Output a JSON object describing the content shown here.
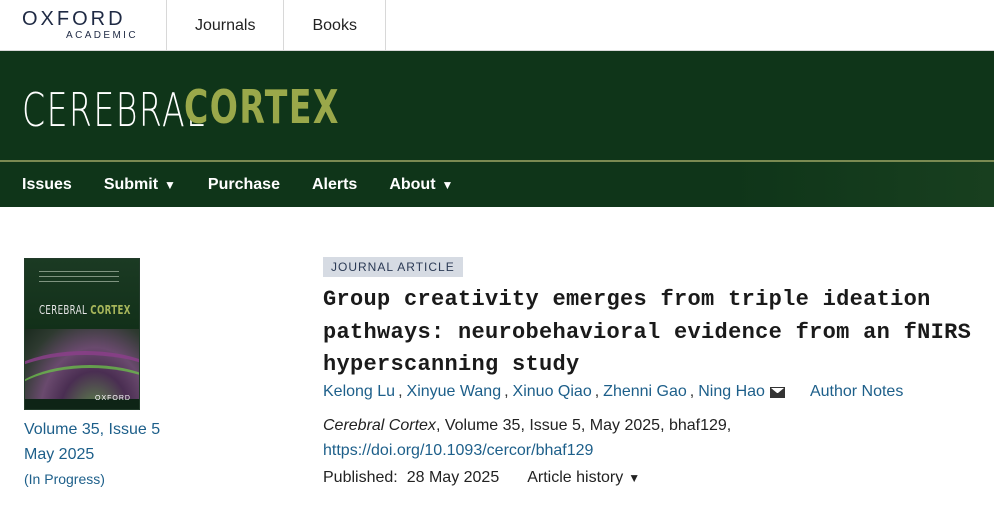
{
  "topbar": {
    "logo_main": "OXFORD",
    "logo_sub": "ACADEMIC",
    "nav": [
      "Journals",
      "Books"
    ]
  },
  "banner": {
    "journal_name_part1": "CEREBRAL",
    "journal_name_part2": "CORTEX"
  },
  "nav": {
    "issues": "Issues",
    "submit": "Submit",
    "purchase": "Purchase",
    "alerts": "Alerts",
    "about": "About",
    "caret": "▼"
  },
  "cover": {
    "title_part1": "CEREBRAL",
    "title_part2": "CORTEX",
    "publisher": "OXFORD"
  },
  "issue": {
    "volume": "Volume 35, Issue 5",
    "date": "May 2025",
    "status": "(In Progress)"
  },
  "article": {
    "type_badge": "JOURNAL ARTICLE",
    "title_line1": "Group creativity emerges from triple ideation",
    "title_line2": "pathways: neurobehavioral evidence from an fNIRS",
    "title_line3": "hyperscanning study",
    "authors": [
      "Kelong Lu",
      "Xinyue Wang",
      "Xinuo Qiao",
      "Zhenni Gao",
      "Ning Hao"
    ],
    "author_separator": ",",
    "author_notes": "Author Notes",
    "citation_journal": "Cerebral Cortex",
    "citation_rest": ", Volume 35, Issue 5, May 2025, bhaf129,",
    "doi": "https://doi.org/10.1093/cercor/bhaf129",
    "published_label": "Published:",
    "published_date": "28 May 2025",
    "history_label": "Article history",
    "history_caret": "▼"
  },
  "colors": {
    "banner_green": "#0f3519",
    "cortex_olive": "#9aa84a",
    "link_blue": "#1d5f8a",
    "badge_bg": "#d6dbe3"
  },
  "icons": {
    "mail": "mail-icon"
  }
}
